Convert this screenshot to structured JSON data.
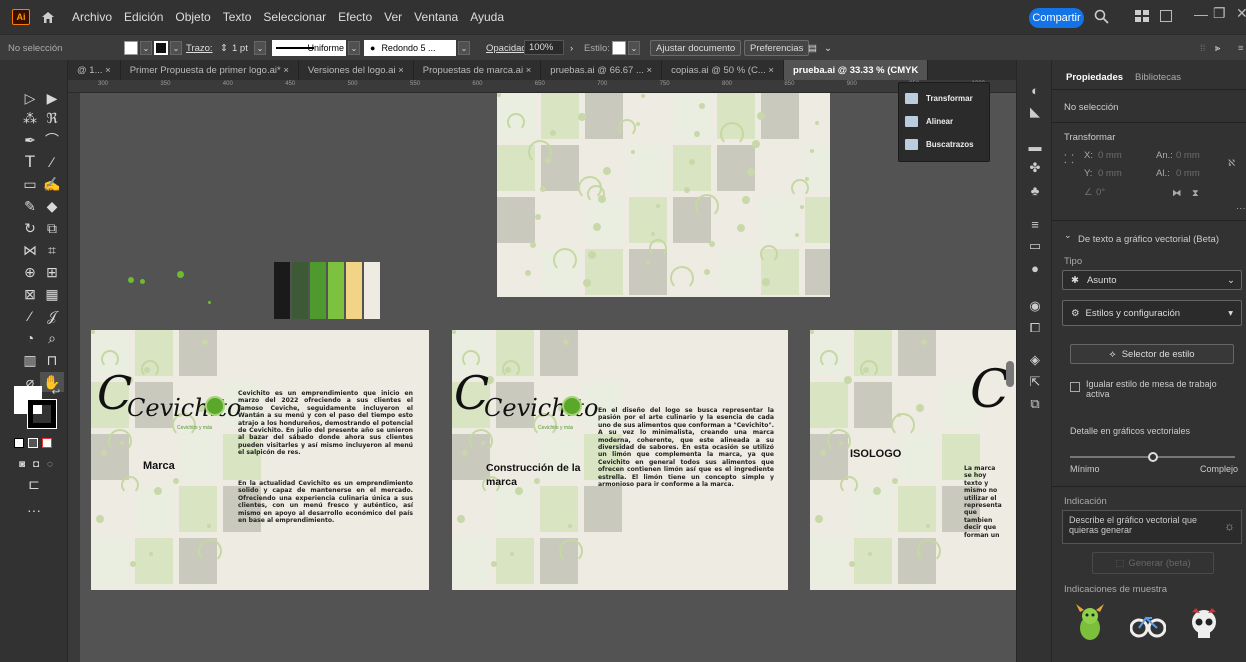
{
  "menubar": {
    "app_logo": "Ai",
    "items": [
      "Archivo",
      "Edición",
      "Objeto",
      "Texto",
      "Seleccionar",
      "Efecto",
      "Ver",
      "Ventana",
      "Ayuda"
    ],
    "share_label": "Compartir"
  },
  "controlbar": {
    "selection_label": "No selección",
    "stroke_label": "Trazo:",
    "stroke_value": "1 pt",
    "profile_label": "Uniforme",
    "brush_label": "Redondo 5 ...",
    "opacity_label": "Opacidad:",
    "opacity_value": "100%",
    "style_label": "Estilo:",
    "fit_doc_button": "Ajustar documento",
    "prefs_button": "Preferencias"
  },
  "tabs": [
    "@ 1... ×",
    "Primer Propuesta de primer logo.ai* ×",
    "Versiones del logo.ai ×",
    "Propuestas de marca.ai ×",
    "pruebas.ai @ 66.67 ... ×",
    "copias.ai @ 50 % (C... ×",
    "prueba.ai @ 33.33 % (CMYK"
  ],
  "ruler_ticks": [
    "300",
    "350",
    "400",
    "450",
    "500",
    "550",
    "600",
    "650",
    "700",
    "750",
    "800",
    "850",
    "900",
    "950",
    "1000"
  ],
  "floating_menu": {
    "items": [
      "Transformar",
      "Alinear",
      "Buscatrazos"
    ]
  },
  "artboards": {
    "brand_name": "Cevichito",
    "tagline": "Cevichito y más",
    "marca_title": "Marca",
    "marca_text_1": "Cevichito es un emprendimiento que inicio en marzo del 2022 ofreciendo a sus clientes el famoso Ceviche, seguidamente incluyeron el Wantán a su menú y con el paso del tiempo esto atrajo a los hondureños, demostrando el potencial de Cevichito. En julio del presente año se unieron al bazar del sábado donde ahora sus clientes pueden visitarles y así mismo incluyeron al menú el salpicón de res.",
    "marca_text_2": "En la actualidad Cevichito es un emprendimiento solido y capaz de mantenerse en el mercado. Ofreciendo una experiencia culinaria única a sus clientes, con un menú fresco y auténtico, así mismo en apoyo al desarrollo económico del país en base al emprendimiento.",
    "construccion_title": "Construcción de la marca",
    "construccion_text": "En el diseño del logo se busca representar la pasión por el arte culinario y la esencia de cada uno de sus alimentos que conforman a \"Cevichito\". A su vez lo minimalista, creando una marca moderna, coherente, que este alineada a su diversidad de sabores. En esta ocasión se utilizó un limón que complementa la marca, ya que Cevichito en general todos sus alimentos que ofrecen contienen limón así que es el ingrediente estrella. El limón tiene un concepto simple y armonioso para ir conforme a la marca.",
    "isologo_title": "ISOLOGO",
    "isologo_text": "La marca se hoy texto y mismo no utilizar el representa que tambien decir que forman un",
    "palette": [
      "#1a1a1a",
      "#3b5a35",
      "#4f9a2f",
      "#7cc23f",
      "#f2d486",
      "#eeebe2"
    ]
  },
  "properties": {
    "tabs": [
      "Propiedades",
      "Bibliotecas"
    ],
    "no_selection": "No selección",
    "transform_label": "Transformar",
    "x_label": "X:",
    "y_label": "Y:",
    "x_value": "0 mm",
    "y_value": "0 mm",
    "w_label": "An.:",
    "h_label": "Al.:",
    "w_value": "0 mm",
    "h_value": "0 mm",
    "angle_value": "0°",
    "t2v_section": "De texto a gráfico vectorial (Beta)",
    "type_label": "Tipo",
    "type_value": "Asunto",
    "styles_section": "Estilos y configuración",
    "style_picker_button": "Selector de estilo",
    "match_style_label": "Igualar estilo de mesa de trabajo activa",
    "detail_label": "Detalle en gráficos vectoriales",
    "detail_min": "Mínimo",
    "detail_max": "Complejo",
    "detail_level": 0.5,
    "prompt_label": "Indicación",
    "prompt_placeholder": "Describe el gráfico vectorial que quieras generar",
    "generate_button": "Generar (beta)",
    "samples_label": "Indicaciones de muestra"
  }
}
